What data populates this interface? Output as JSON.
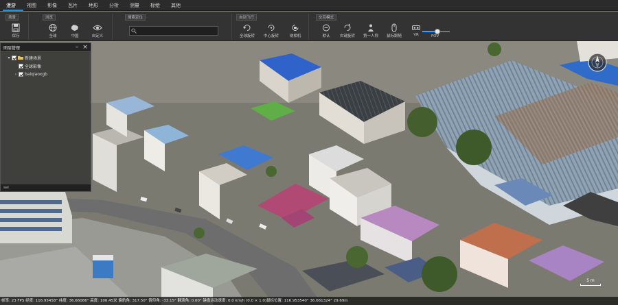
{
  "menu": {
    "items": [
      {
        "label": "漫游",
        "active": true
      },
      {
        "label": "视图",
        "active": false
      },
      {
        "label": "影像",
        "active": false
      },
      {
        "label": "瓦片",
        "active": false
      },
      {
        "label": "地形",
        "active": false
      },
      {
        "label": "分析",
        "active": false
      },
      {
        "label": "测量",
        "active": false
      },
      {
        "label": "标绘",
        "active": false
      },
      {
        "label": "其他",
        "active": false
      }
    ]
  },
  "ribbon": {
    "groups": {
      "scene": "场景",
      "browse": "浏览",
      "search": "搜索定位",
      "auto_fly": "自动飞行",
      "interaction": "交互模式"
    },
    "tools": {
      "save": "保存",
      "global": "全球",
      "china": "中国",
      "custom": "自定义",
      "global_rotate": "全球旋转",
      "center_rotate": "中心旋转",
      "around_camera": "绕相机",
      "default": "默认",
      "right_rotate": "右键旋转",
      "first_person": "第一人称",
      "mouse_follow": "鼠标跟随",
      "vr": "VR",
      "fov": "FOV"
    },
    "search": {
      "value": "",
      "placeholder": ""
    },
    "fov_level": 0.55
  },
  "layer_panel": {
    "title": "图层管理",
    "items": [
      {
        "label": "新建场景",
        "checked": true,
        "level": 0,
        "expander": "▾",
        "folder": true
      },
      {
        "label": "全球影像",
        "checked": true,
        "level": 1,
        "expander": "",
        "folder": false
      },
      {
        "label": "baiqiaoxgb",
        "checked": true,
        "level": 1,
        "expander": "›",
        "folder": false
      }
    ],
    "footer": "sel"
  },
  "scale": {
    "label": "5 m"
  },
  "status": {
    "text": "帧率: 23 FPS 经度: 116.95458° 纬度: 36.66086° 高度: 106.45米 偏航角: 317.50° 俯仰角: -33.15° 翻滚角: 0.00° 键盘运动速度: 0.0 km/h (0.0 × 1.0)鼠标位置: 116.953540° 36.661324° 29.69m"
  },
  "colors": {
    "menubar": "#2b2b2b",
    "ribbon": "#333333",
    "accent": "#2b8fd6"
  },
  "icons": {
    "save": "floppy-icon",
    "global": "globe-icon",
    "china": "map-china-icon",
    "custom": "eye-icon",
    "rotate": "rotate-icon",
    "person": "person-icon",
    "mouse": "mouse-icon",
    "vr": "vr-headset-icon",
    "compass": "compass-icon"
  }
}
